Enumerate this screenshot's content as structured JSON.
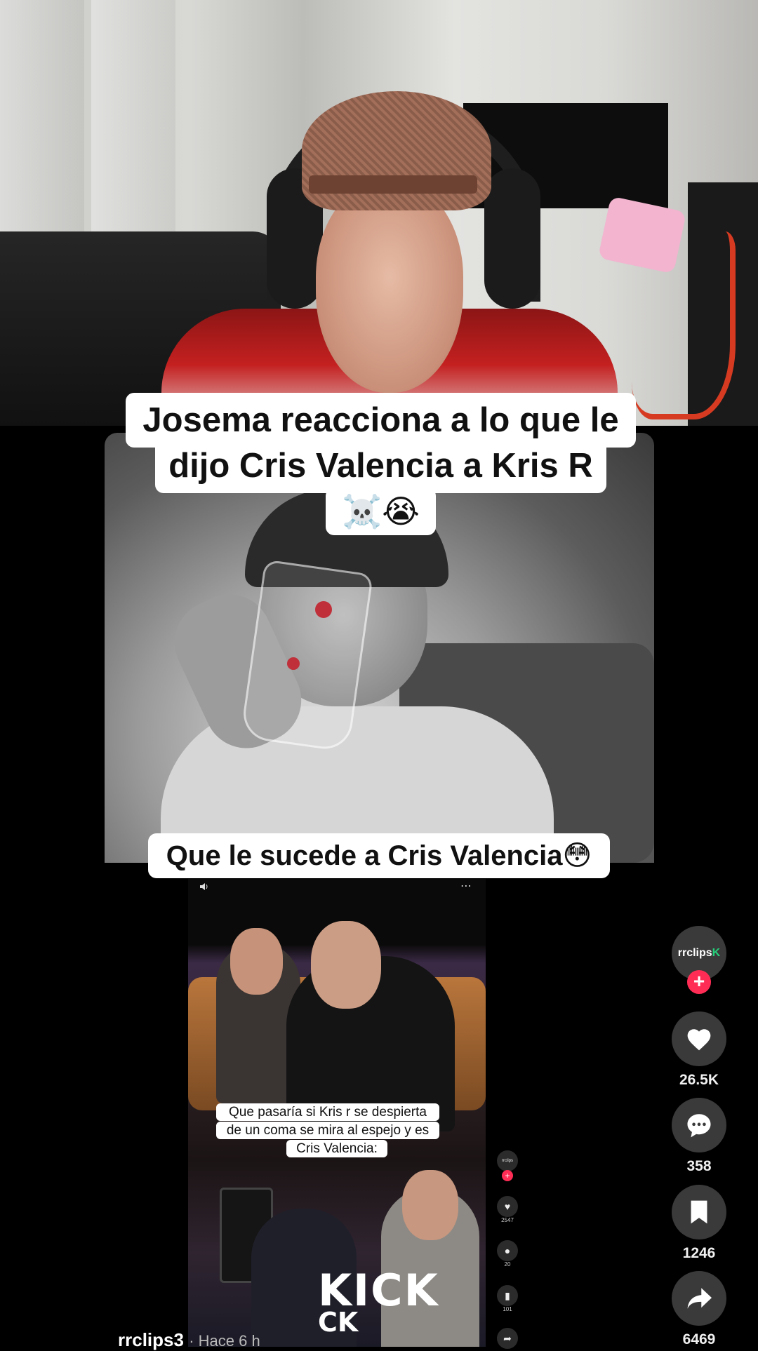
{
  "title_lines": [
    "Josema reacciona a lo que le",
    "dijo Cris Valencia a Kris R",
    "☠️😭"
  ],
  "subtitle": "Que le sucede a Cris Valencia😳",
  "inner_video": {
    "caption_lines": [
      "Que pasaría si Kris r se despierta",
      "de un coma se mira al espejo y es",
      "Cris Valencia:"
    ],
    "brand_text": "KICK",
    "brand_text_2": "CK",
    "more_icon": "⋯",
    "rail": {
      "avatar_label": "rrclips",
      "likes": "2547",
      "comments": "20",
      "saves": "101"
    }
  },
  "rail": {
    "avatar_text": "rrclips",
    "avatar_accent": "K",
    "follow_label": "+",
    "likes": "26.5K",
    "comments": "358",
    "saves": "1246",
    "shares": "6469"
  },
  "footer": {
    "username": "rrclips3",
    "time": "· Hace 6 h"
  },
  "colors": {
    "follow": "#ff2d55",
    "accent_green": "#25d07b"
  }
}
